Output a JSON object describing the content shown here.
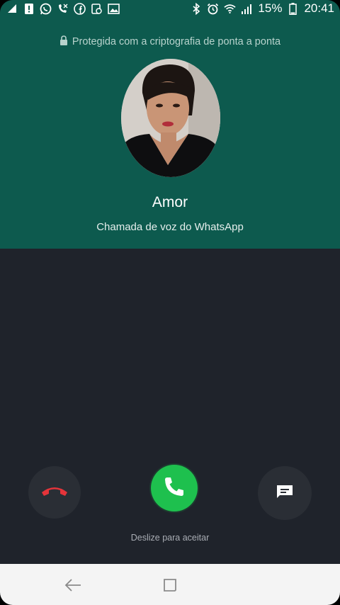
{
  "status_bar": {
    "battery_percent": "15%",
    "time": "20:41",
    "left_icons": [
      "notification-icon",
      "sim-alert-icon",
      "whatsapp-icon",
      "missed-call-icon",
      "facebook-icon",
      "voicemail-icon",
      "gallery-icon"
    ],
    "right_icons": [
      "bluetooth-icon",
      "alarm-icon",
      "wifi-icon",
      "signal-icon",
      "battery-icon"
    ]
  },
  "call": {
    "encryption_notice": "Protegida com a criptografia de ponta a ponta",
    "caller_name": "Amor",
    "call_type": "Chamada de voz do WhatsApp",
    "swipe_hint": "Deslize para aceitar"
  },
  "colors": {
    "header_bg": "#0d5a4e",
    "body_bg": "#1f232b",
    "accept": "#1ec04e",
    "decline_icon": "#e5343a"
  }
}
